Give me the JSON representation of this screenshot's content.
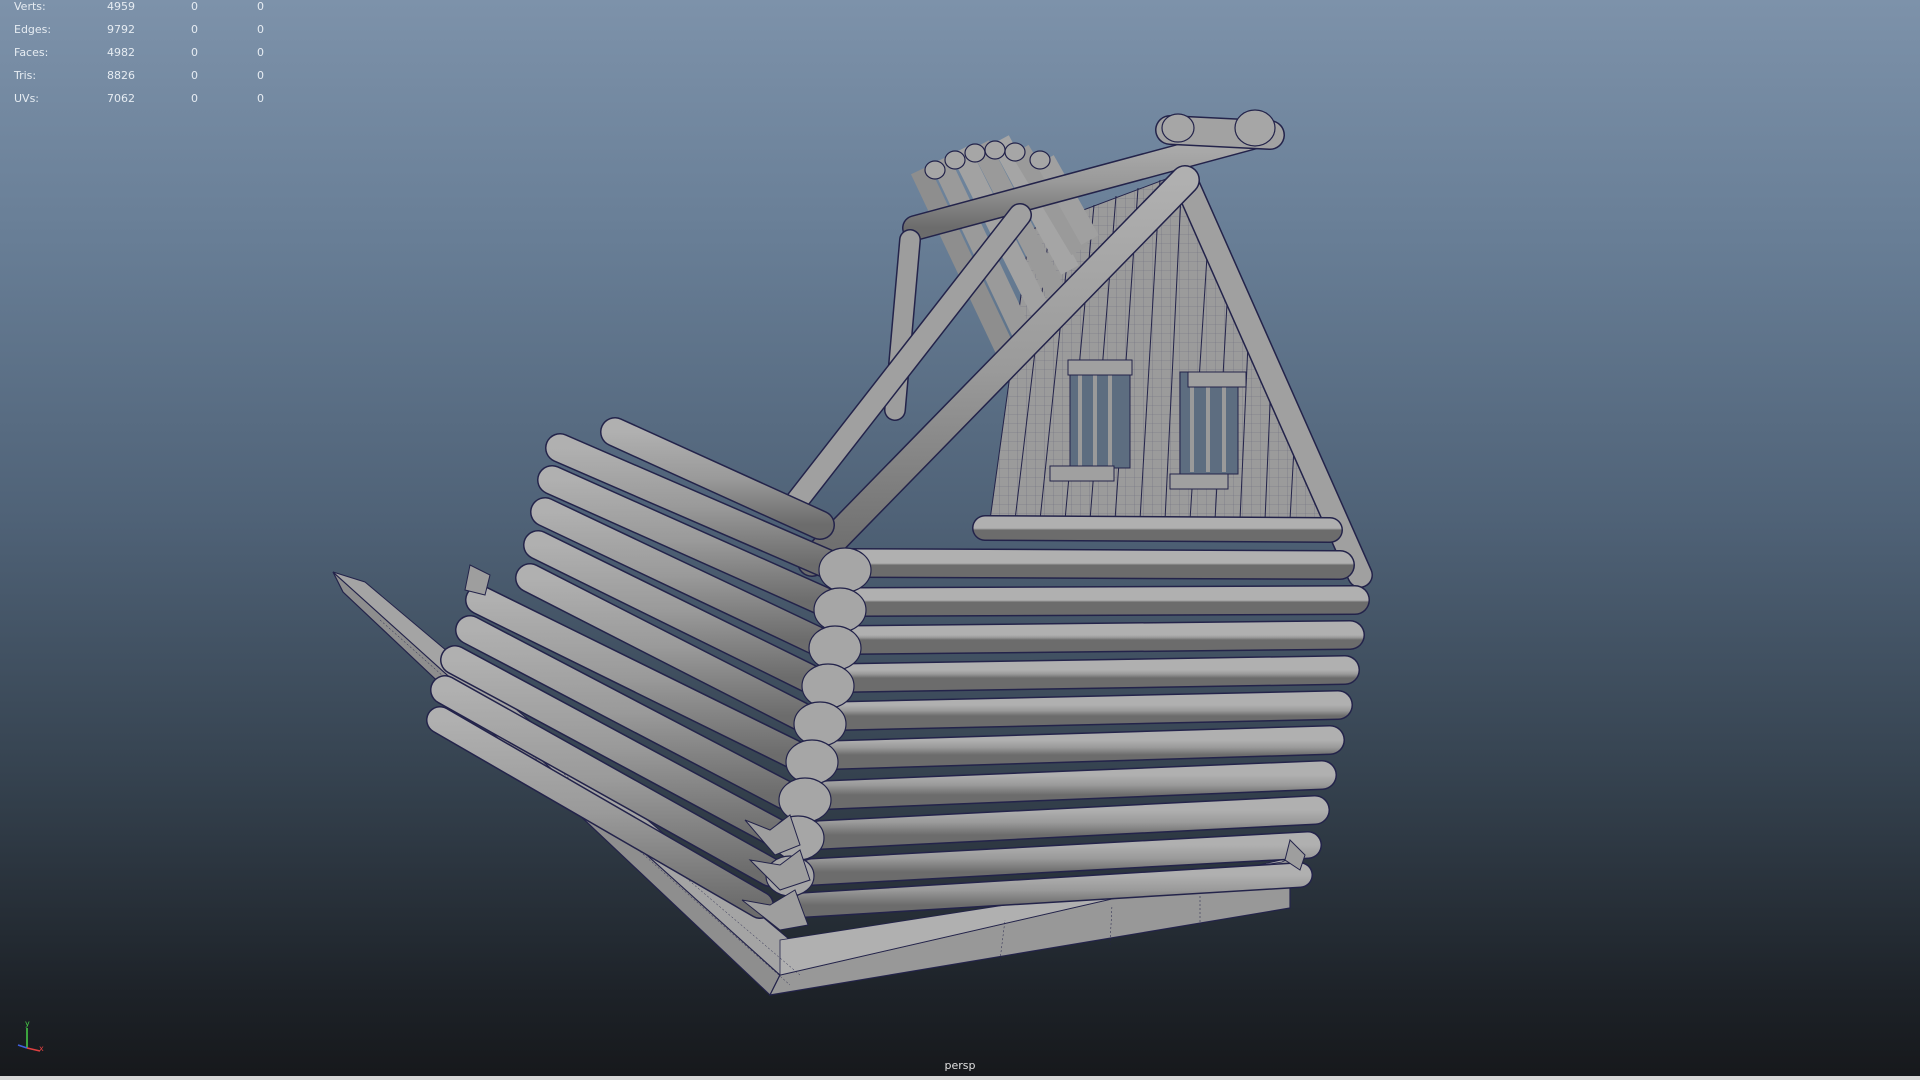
{
  "hud": {
    "rows": [
      {
        "label": "Verts:",
        "total": "4959",
        "selected": "0",
        "component": "0"
      },
      {
        "label": "Edges:",
        "total": "9792",
        "selected": "0",
        "component": "0"
      },
      {
        "label": "Faces:",
        "total": "4982",
        "selected": "0",
        "component": "0"
      },
      {
        "label": "Tris:",
        "total": "8826",
        "selected": "0",
        "component": "0"
      },
      {
        "label": "UVs:",
        "total": "7062",
        "selected": "0",
        "component": "0"
      }
    ]
  },
  "viewport": {
    "camera": "persp",
    "background_top": "#7d92aa",
    "background_bottom": "#16181b",
    "mesh_color": "#9a9a9a",
    "wire_color": "#23234a"
  },
  "axis_gizmo": {
    "icon": "axis-gizmo-icon",
    "x_color": "#e04040",
    "y_color": "#48d048",
    "z_color": "#4060e0",
    "y_label": "y",
    "x_label": "x"
  }
}
